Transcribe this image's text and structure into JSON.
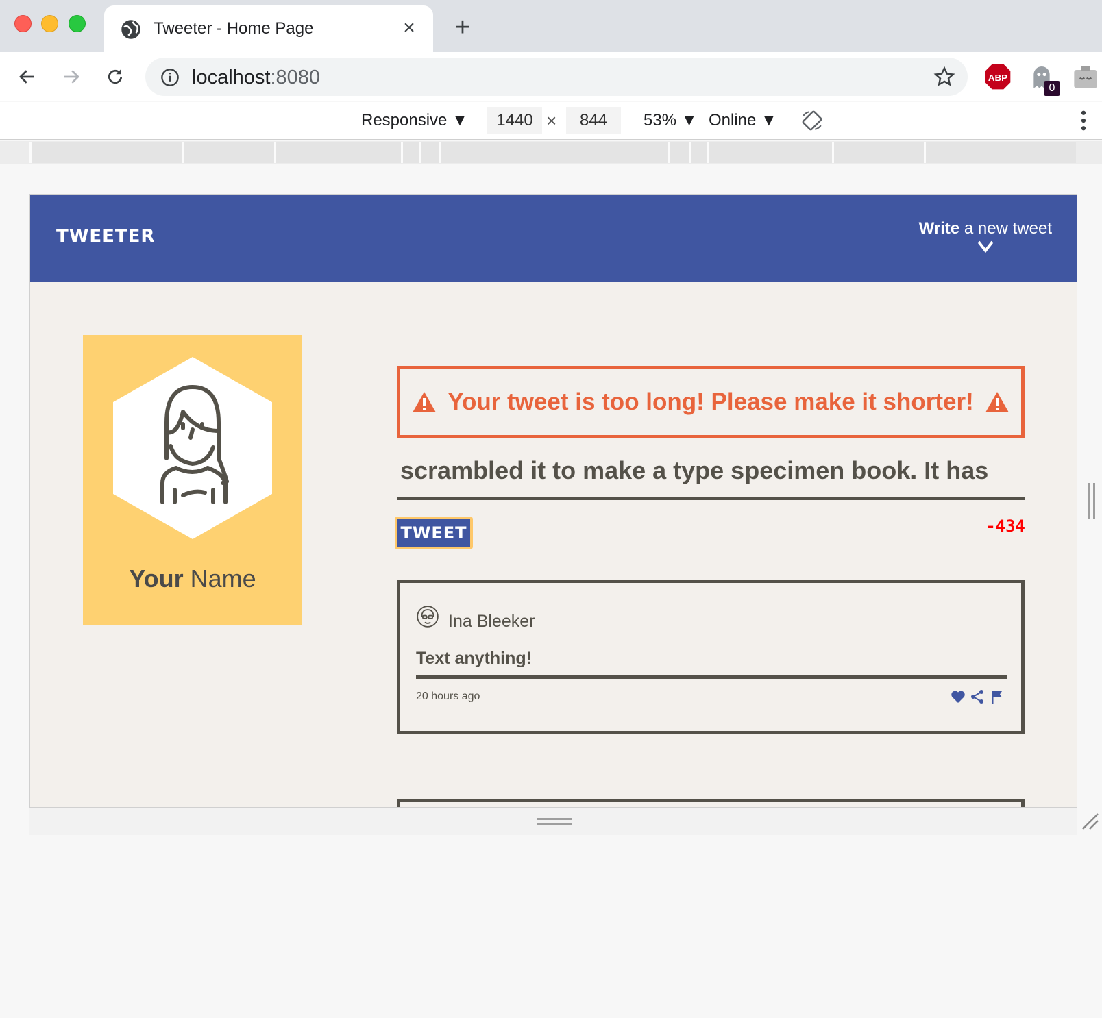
{
  "browser": {
    "tab_title": "Tweeter - Home Page",
    "close_glyph": "×",
    "new_tab_glyph": "+",
    "url_host": "localhost",
    "url_port": ":8080",
    "extension_badge": "0"
  },
  "devtools": {
    "device": "Responsive ▼",
    "width": "1440",
    "height": "844",
    "times": "×",
    "zoom": "53% ▼",
    "network": "Online ▼"
  },
  "site": {
    "logo": "TWEETER",
    "compose_bold": "Write",
    "compose_rest": " a new tweet",
    "profile_name_bold": "Your",
    "profile_name_rest": " Name",
    "error_message": "Your tweet is too long! Please make it shorter!",
    "tweet_input_visible_line": "scrambled it to make a type specimen book. It has",
    "tweet_button": "TWEET",
    "char_counter": "-434",
    "tweets": [
      {
        "author": "Ina Bleeker",
        "text": "Text anything!",
        "time": "20 hours ago"
      }
    ]
  },
  "colors": {
    "header_blue": "#4056a1",
    "profile_yellow": "#fed171",
    "error_orange": "#e8643c",
    "text_dark": "#545149",
    "counter_red": "#ff0000"
  },
  "icons": [
    "globe-icon",
    "close-icon",
    "plus-icon",
    "back-arrow-icon",
    "forward-arrow-icon",
    "reload-icon",
    "info-icon",
    "star-icon",
    "adblock-icon",
    "ghostery-icon",
    "extension-icon",
    "rotate-icon",
    "kebab-menu-icon",
    "chevron-down-icon",
    "warning-icon",
    "heart-icon",
    "share-icon",
    "flag-icon"
  ]
}
